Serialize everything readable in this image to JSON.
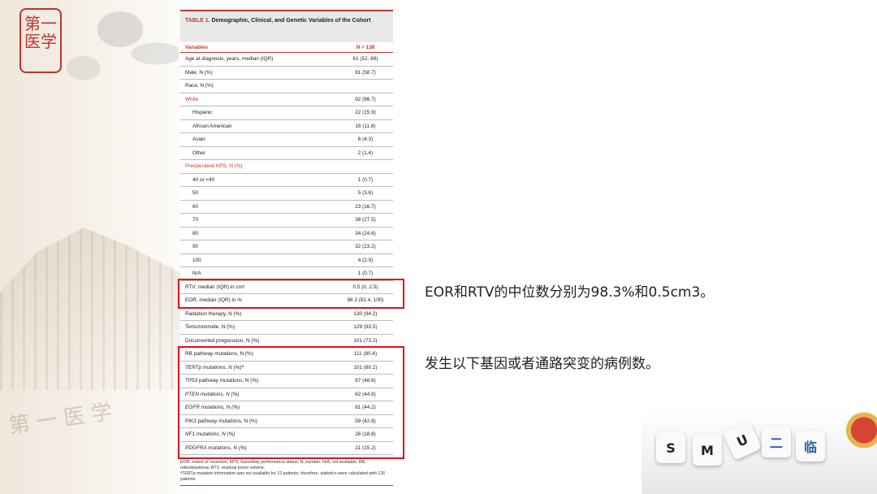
{
  "table": {
    "title_label": "TABLE 1.",
    "title_text": "Demographic, Clinical, and Genetic Variables of the Cohort",
    "col_variable": "Variables",
    "col_n": "N = 138",
    "rows": [
      {
        "label": "Age at diagnosis, years, median (IQR)",
        "value": "61 (52, 69)"
      },
      {
        "label": "Male, N (%)",
        "value": "81 (58.7)"
      },
      {
        "label": "Race, N (%)",
        "value": ""
      },
      {
        "label": "White",
        "value": "92 (66.7)"
      },
      {
        "label": "Hispanic",
        "value": "22 (15.9)"
      },
      {
        "label": "African American",
        "value": "16 (11.6)"
      },
      {
        "label": "Asian",
        "value": "6 (4.3)"
      },
      {
        "label": "Other",
        "value": "2 (1.4)"
      },
      {
        "label": "Preoperative KPS, N (%)",
        "value": ""
      },
      {
        "label": "40 or <40",
        "value": "1 (0.7)"
      },
      {
        "label": "50",
        "value": "5 (3.6)"
      },
      {
        "label": "60",
        "value": "23 (16.7)"
      },
      {
        "label": "70",
        "value": "38 (27.5)"
      },
      {
        "label": "80",
        "value": "34 (24.6)"
      },
      {
        "label": "90",
        "value": "32 (23.2)"
      },
      {
        "label": "100",
        "value": "4 (2.9)"
      },
      {
        "label": "N/A",
        "value": "1 (0.7)"
      },
      {
        "label": "RTV, median (IQR) in cm³",
        "value": "0.5 (0, 2.5)"
      },
      {
        "label": "EOR, median (IQR) in %",
        "value": "98.3 (92.4, 100)"
      },
      {
        "label": "Radiation therapy, N (%)",
        "value": "130 (94.2)"
      },
      {
        "label": "Temozolomide, N (%)",
        "value": "129 (93.5)"
      },
      {
        "label": "Documented progression, N (%)",
        "value": "101 (73.2)"
      },
      {
        "label": "RB pathway mutations, N (%)",
        "value": "111 (80.4)"
      },
      {
        "label": "TERTp mutations, N (%)ª",
        "value": "101 (80.2)"
      },
      {
        "label": "TP53 pathway mutations, N (%)",
        "value": "67 (48.6)"
      },
      {
        "label": "PTEN mutations, N (%)",
        "value": "62 (44.9)"
      },
      {
        "label": "EGFR mutations, N (%)",
        "value": "61 (44.2)"
      },
      {
        "label": "PIK3 pathway mutations, N (%)",
        "value": "59 (42.8)"
      },
      {
        "label": "NF1 mutations, N (%)",
        "value": "26 (18.8)"
      },
      {
        "label": "PDGFRA mutations, N (%)",
        "value": "21 (15.2)"
      }
    ],
    "footnote_1": "EOR, extent of resection; KPS, Karnofsky performance status; N, number; N/A, not available; RB, retinoblastoma; RTV, residual tumor volume.",
    "footnote_2": "ªTERTp mutation information was not available for 12 patients; therefore, statistics were calculated with 126 patients."
  },
  "notes": {
    "median_note": "EOR和RTV的中位数分别为98.3%和0.5cm3。",
    "mutation_note": "发生以下基因或者通路突变的病例数。"
  },
  "seal": {
    "text": "第一医学"
  },
  "dice": [
    "S",
    "M",
    "U",
    "二",
    "临"
  ],
  "colors": {
    "accent_red": "#c0392b",
    "highlight_red": "#e0101c"
  }
}
